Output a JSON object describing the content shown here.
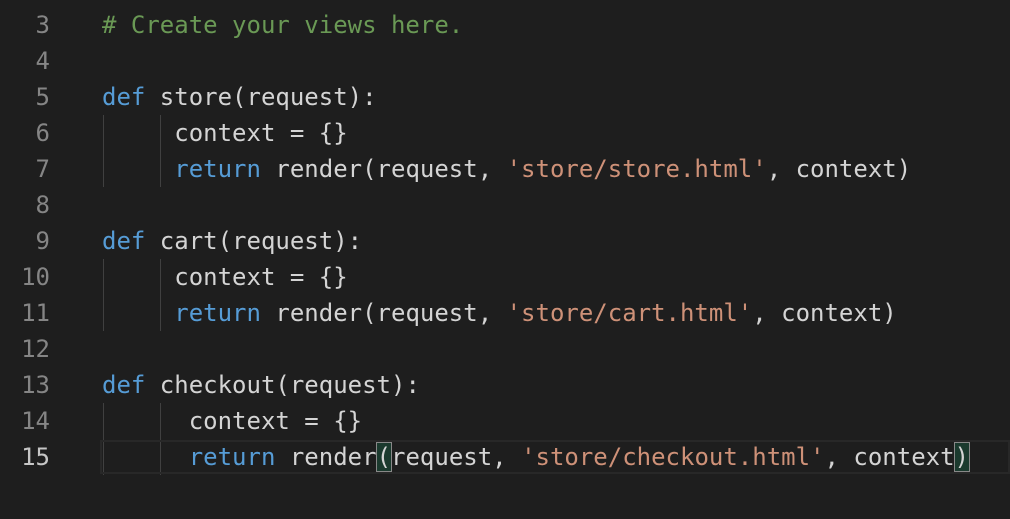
{
  "editor": {
    "lines": [
      {
        "number": "3",
        "indent": 0,
        "tokens": [
          {
            "t": "# Create your views here.",
            "c": "com"
          }
        ]
      },
      {
        "number": "4",
        "indent": 0,
        "tokens": []
      },
      {
        "number": "5",
        "indent": 0,
        "tokens": [
          {
            "t": "def",
            "c": "kw"
          },
          {
            "t": " store(request):",
            "c": "plain"
          }
        ]
      },
      {
        "number": "6",
        "indent": 1,
        "tokens": [
          {
            "t": "     context = {}",
            "c": "plain"
          }
        ]
      },
      {
        "number": "7",
        "indent": 1,
        "tokens": [
          {
            "t": "     ",
            "c": "plain"
          },
          {
            "t": "return",
            "c": "kw"
          },
          {
            "t": " render(request, ",
            "c": "plain"
          },
          {
            "t": "'store/store.html'",
            "c": "str"
          },
          {
            "t": ", context)",
            "c": "plain"
          }
        ]
      },
      {
        "number": "8",
        "indent": 0,
        "tokens": []
      },
      {
        "number": "9",
        "indent": 0,
        "tokens": [
          {
            "t": "def",
            "c": "kw"
          },
          {
            "t": " cart(request):",
            "c": "plain"
          }
        ]
      },
      {
        "number": "10",
        "indent": 1,
        "tokens": [
          {
            "t": "     context = {}",
            "c": "plain"
          }
        ]
      },
      {
        "number": "11",
        "indent": 1,
        "tokens": [
          {
            "t": "     ",
            "c": "plain"
          },
          {
            "t": "return",
            "c": "kw"
          },
          {
            "t": " render(request, ",
            "c": "plain"
          },
          {
            "t": "'store/cart.html'",
            "c": "str"
          },
          {
            "t": ", context)",
            "c": "plain"
          }
        ]
      },
      {
        "number": "12",
        "indent": 0,
        "tokens": []
      },
      {
        "number": "13",
        "indent": 0,
        "tokens": [
          {
            "t": "def",
            "c": "kw"
          },
          {
            "t": " checkout(request):",
            "c": "plain"
          }
        ]
      },
      {
        "number": "14",
        "indent": 1,
        "tokens": [
          {
            "t": "      context = {}",
            "c": "plain"
          }
        ]
      },
      {
        "number": "15",
        "indent": 1,
        "active": true,
        "tokens": [
          {
            "t": "      ",
            "c": "plain"
          },
          {
            "t": "return",
            "c": "kw"
          },
          {
            "t": " render",
            "c": "plain"
          },
          {
            "t": "(",
            "c": "plain",
            "match": true
          },
          {
            "t": "request, ",
            "c": "plain"
          },
          {
            "t": "'store/checkout.html'",
            "c": "str"
          },
          {
            "t": ", context",
            "c": "plain"
          },
          {
            "t": ")",
            "c": "plain",
            "match": true
          }
        ]
      }
    ]
  }
}
